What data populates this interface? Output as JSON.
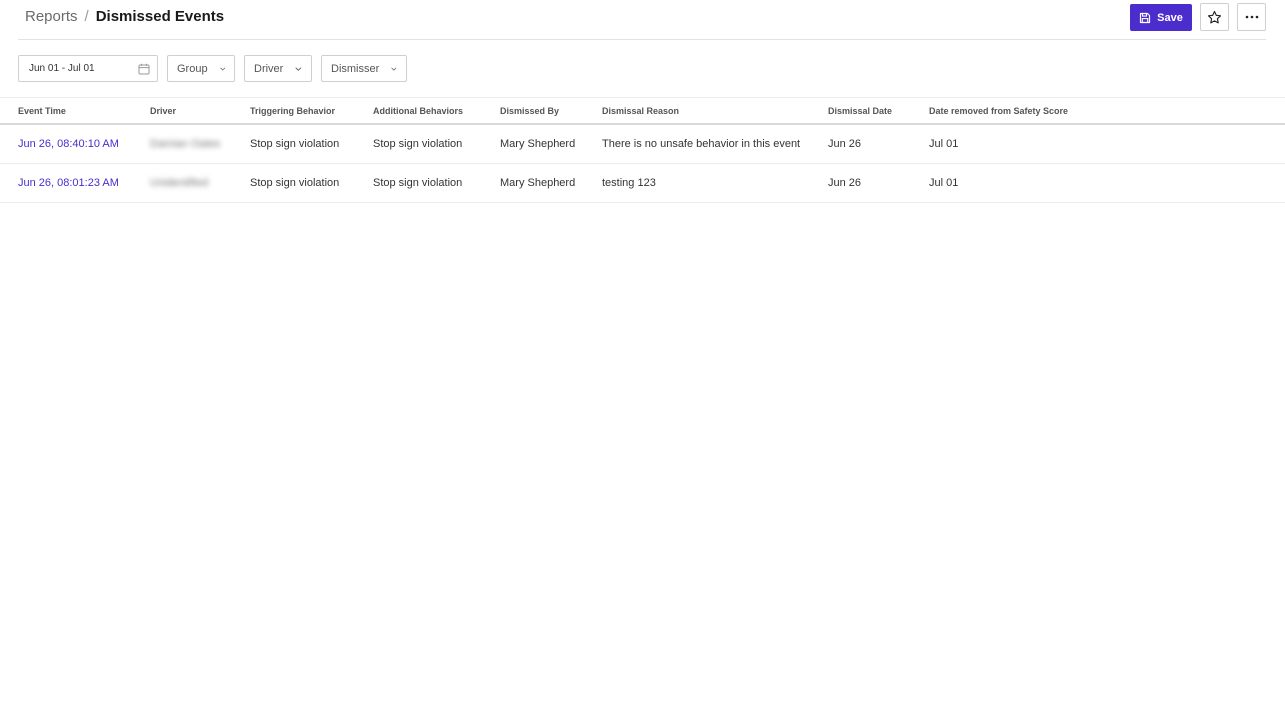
{
  "breadcrumb": {
    "parent": "Reports",
    "separator": "/",
    "current": "Dismissed Events"
  },
  "toolbar": {
    "save_label": "Save",
    "save_icon": "floppy-disk-icon",
    "favorite_icon": "star-icon",
    "more_icon": "ellipsis-icon"
  },
  "filters": {
    "date_range": "Jun 01 - Jul 01",
    "group_label": "Group",
    "driver_label": "Driver",
    "dismisser_label": "Dismisser"
  },
  "table": {
    "columns": [
      "Event Time",
      "Driver",
      "Triggering Behavior",
      "Additional Behaviors",
      "Dismissed By",
      "Dismissal Reason",
      "Dismissal Date",
      "Date removed from Safety Score"
    ],
    "rows": [
      {
        "event_time": "Jun 26, 08:40:10 AM",
        "driver": "Damian Oates",
        "triggering_behavior": "Stop sign violation",
        "additional_behaviors": "Stop sign violation",
        "dismissed_by": "Mary Shepherd",
        "dismissal_reason": "There is no unsafe behavior in this event",
        "dismissal_date": "Jun 26",
        "date_removed": "Jul 01"
      },
      {
        "event_time": "Jun 26, 08:01:23 AM",
        "driver": "Unidentified",
        "triggering_behavior": "Stop sign violation",
        "additional_behaviors": "Stop sign violation",
        "dismissed_by": "Mary Shepherd",
        "dismissal_reason": "testing 123",
        "dismissal_date": "Jun 26",
        "date_removed": "Jul 01"
      }
    ]
  },
  "colors": {
    "accent": "#4b2ccc",
    "border": "#cfcfcf"
  }
}
